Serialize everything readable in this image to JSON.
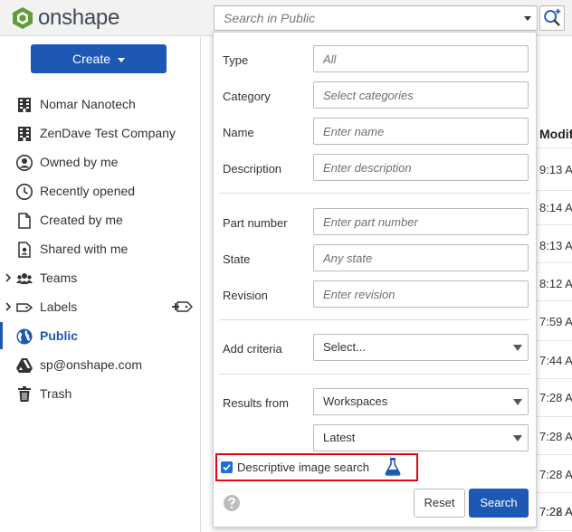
{
  "app": {
    "logo_text": "onshape",
    "search_placeholder": "Search in Public"
  },
  "sidebar": {
    "create_label": "Create",
    "items": [
      {
        "label": "Nomar Nanotech",
        "icon": "building-icon"
      },
      {
        "label": "ZenDave Test Company",
        "icon": "building-icon"
      },
      {
        "label": "Owned by me",
        "icon": "user-circle-icon"
      },
      {
        "label": "Recently opened",
        "icon": "clock-icon"
      },
      {
        "label": "Created by me",
        "icon": "document-icon"
      },
      {
        "label": "Shared with me",
        "icon": "shared-document-icon"
      },
      {
        "label": "Teams",
        "icon": "teams-icon"
      },
      {
        "label": "Labels",
        "icon": "label-icon"
      },
      {
        "label": "Public",
        "icon": "globe-icon",
        "active": true
      },
      {
        "label": "sp@onshape.com",
        "icon": "drive-icon"
      },
      {
        "label": "Trash",
        "icon": "trash-icon"
      }
    ]
  },
  "content": {
    "column_header": "Modif",
    "row_times": [
      "9:13 A",
      "8:14 A",
      "8:13 A",
      "8:12 A",
      "7:59 A",
      "7:44 A",
      "7:28 A",
      "7:28 A",
      "7:28 A",
      "7:28 A",
      "7:22 A"
    ]
  },
  "advanced_search": {
    "fields": {
      "type": {
        "label": "Type",
        "placeholder": "All"
      },
      "category": {
        "label": "Category",
        "placeholder": "Select categories"
      },
      "name": {
        "label": "Name",
        "placeholder": "Enter name"
      },
      "description": {
        "label": "Description",
        "placeholder": "Enter description"
      },
      "part_number": {
        "label": "Part number",
        "placeholder": "Enter part number"
      },
      "state": {
        "label": "State",
        "placeholder": "Any state"
      },
      "revision": {
        "label": "Revision",
        "placeholder": "Enter revision"
      }
    },
    "add_criteria": {
      "label": "Add criteria",
      "value": "Select..."
    },
    "results_from": {
      "label": "Results from",
      "value": "Workspaces",
      "version": "Latest"
    },
    "descriptive_image_search": {
      "label": "Descriptive image search",
      "checked": true
    },
    "reset_label": "Reset",
    "search_label": "Search"
  },
  "colors": {
    "accent": "#1d58b4",
    "highlight_border": "#e30613",
    "logo_green": "#5d9e3b"
  }
}
